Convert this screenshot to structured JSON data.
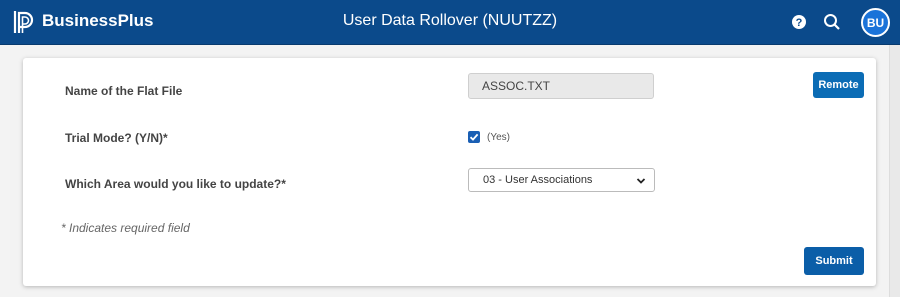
{
  "header": {
    "brand": "BusinessPlus",
    "title": "User Data Rollover (NUUTZZ)",
    "avatar_initials": "BU",
    "icons": [
      "powerschool-logo-icon",
      "help-icon",
      "search-icon"
    ],
    "background": "#0b4a8b"
  },
  "form": {
    "flat_file": {
      "label": "Name of the Flat File",
      "value": "ASSOC.TXT"
    },
    "remote_button": "Remote",
    "trial_mode": {
      "label": "Trial Mode? (Y/N)*",
      "checked": true,
      "checkbox_text": "(Yes)"
    },
    "area": {
      "label": "Which Area would you like to update?*",
      "selected": "03 - User Associations"
    },
    "required_note": "* Indicates required field",
    "submit_button": "Submit"
  },
  "colors": {
    "accent": "#0b6cb5",
    "checkbox": "#1a5fb4"
  }
}
